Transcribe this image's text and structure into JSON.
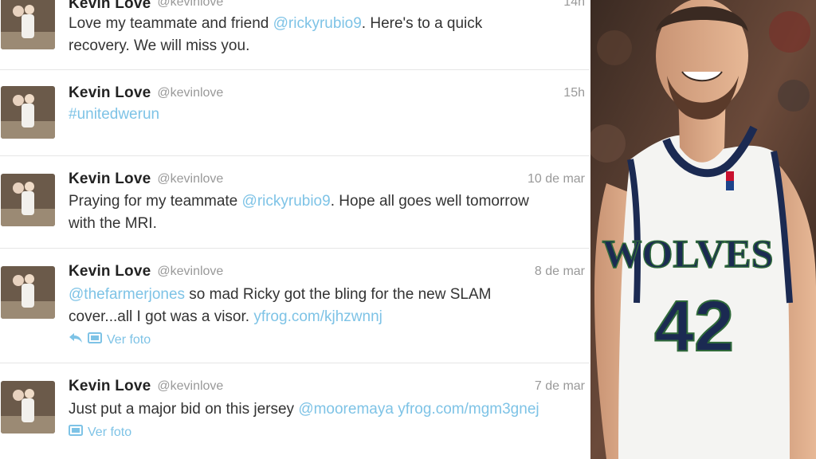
{
  "tweets": [
    {
      "name": "Kevin Love",
      "handle": "@kevinlove",
      "time": "14h",
      "t1": "Love my teammate and friend ",
      "l1": "@rickyrubio9",
      "t2": ". Here's to a quick",
      "line2": "recovery. We will miss you."
    },
    {
      "name": "Kevin Love",
      "handle": "@kevinlove",
      "time": "15h",
      "hashtag": "#unitedwerun"
    },
    {
      "name": "Kevin Love",
      "handle": "@kevinlove",
      "time": "10 de mar",
      "t1": "Praying for my teammate ",
      "l1": "@rickyrubio9",
      "t2": ". Hope all goes well tomorrow",
      "line2": "with the MRI."
    },
    {
      "name": "Kevin Love",
      "handle": "@kevinlove",
      "time": "8 de mar",
      "l1": "@thefarmerjones",
      "t1": " so mad Ricky got the bling for the new SLAM",
      "t2": "cover...all I got was a visor. ",
      "l2": "yfrog.com/kjhzwnnj",
      "action": "Ver foto"
    },
    {
      "name": "Kevin Love",
      "handle": "@kevinlove",
      "time": "7 de mar",
      "t1": "Just put a major bid on this jersey ",
      "l1": "@mooremaya",
      "t2": " ",
      "l2": "yfrog.com/mgm3gnej",
      "action": "Ver foto"
    }
  ],
  "photo": {
    "team": "WOLVES",
    "number": "42"
  },
  "colors": {
    "link": "#7ec3e6",
    "name": "#222222",
    "meta": "#999999",
    "text": "#333333"
  }
}
